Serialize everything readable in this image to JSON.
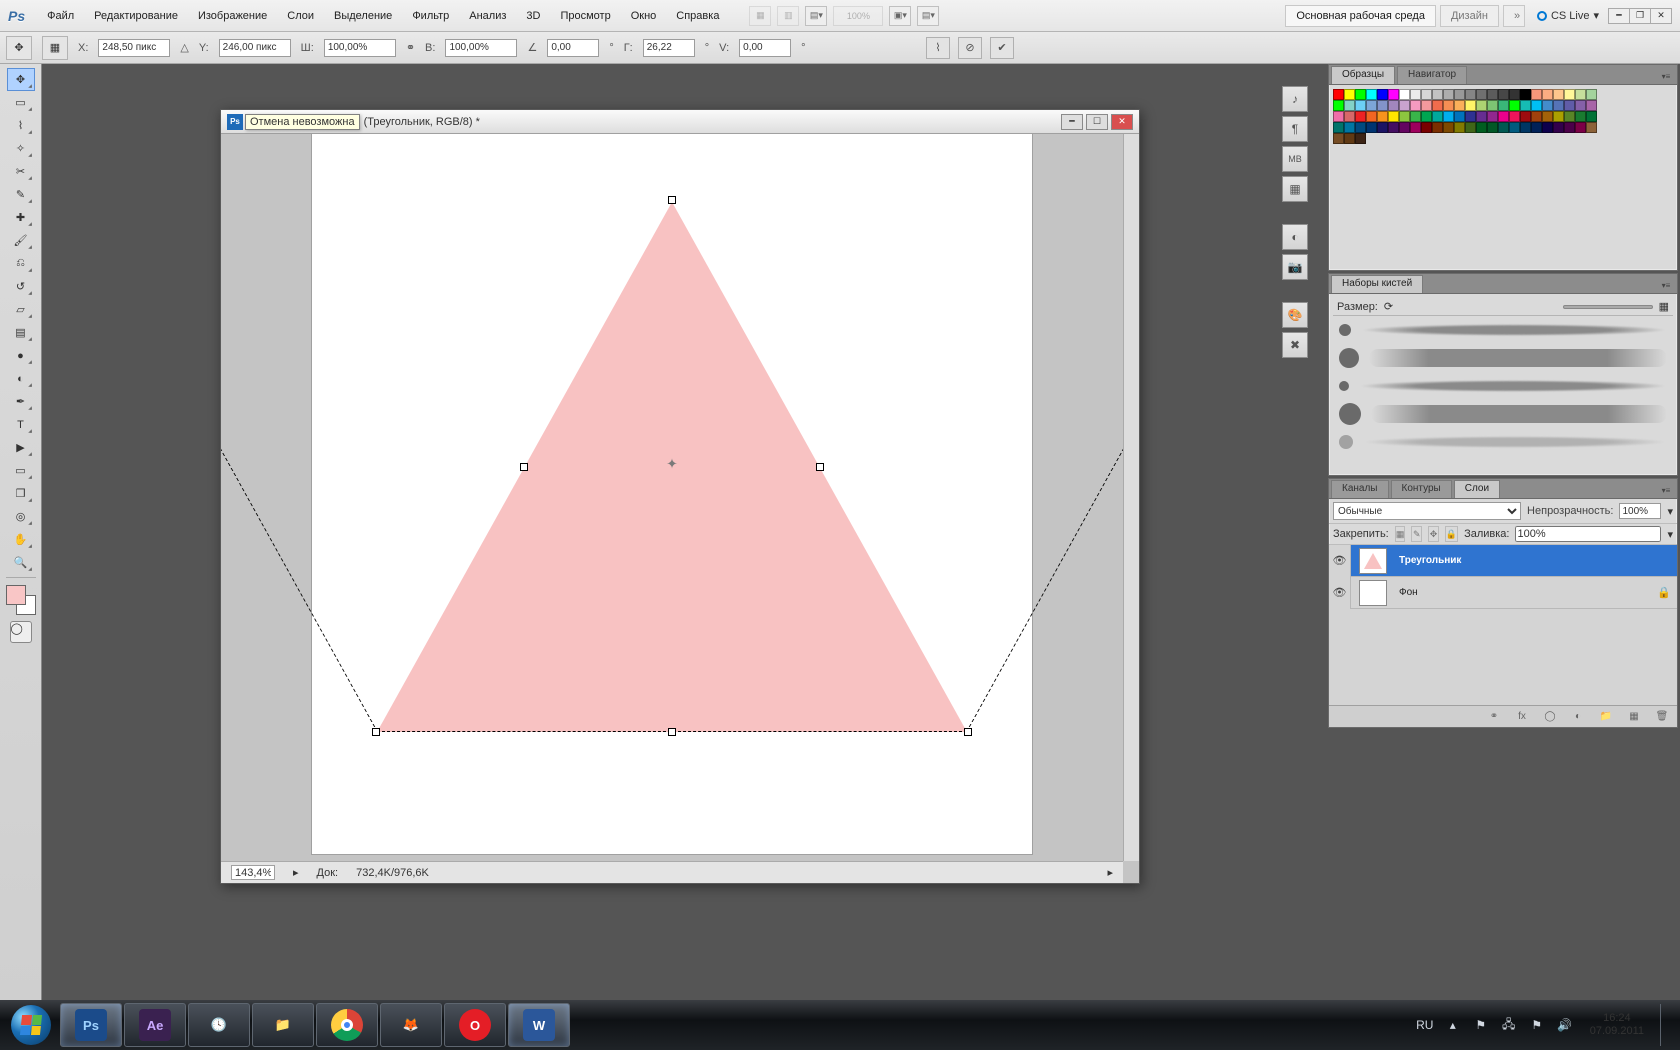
{
  "app": {
    "logo": "Ps"
  },
  "menu": {
    "file": "Файл",
    "edit": "Редактирование",
    "image": "Изображение",
    "layers": "Слои",
    "select": "Выделение",
    "filter": "Фильтр",
    "analysis": "Анализ",
    "3d": "3D",
    "view": "Просмотр",
    "window": "Окно",
    "help": "Справка"
  },
  "top_extra": {
    "zoom_pct": "100%"
  },
  "workspaces": {
    "main": "Основная рабочая среда",
    "design": "Дизайн"
  },
  "cslive": "CS Live",
  "options": {
    "x_label": "X:",
    "x_val": "248,50 пикс",
    "y_label": "Y:",
    "y_val": "246,00 пикс",
    "w_label": "Ш:",
    "w_val": "100,00%",
    "h_label": "В:",
    "h_val": "100,00%",
    "ang_label": "",
    "ang_val": "0,00",
    "gdeg": "°",
    "gh_label": "Г:",
    "gh_val": "26,22",
    "gv_label": "V:",
    "gv_val": "0,00"
  },
  "doc": {
    "tooltip": "Отмена невозможна",
    "title": "(Треугольник, RGB/8) *",
    "zoom": "143,4%",
    "docsize_label": "Док:",
    "docsize": "732,4K/976,6K"
  },
  "panels": {
    "swatches": {
      "tab1": "Образцы",
      "tab2": "Навигатор"
    },
    "brushes": {
      "tab": "Наборы кистей",
      "size_label": "Размер:"
    },
    "channels": "Каналы",
    "paths": "Контуры",
    "layers": "Слои",
    "blend": "Обычные",
    "opacity_label": "Непрозрачность:",
    "opacity_val": "100%",
    "lock_label": "Закрепить:",
    "fill_label": "Заливка:",
    "fill_val": "100%",
    "layer1": "Треугольник",
    "layer2": "Фон"
  },
  "swatches_colors": [
    "#ff0000",
    "#ffff00",
    "#00ff00",
    "#00ffff",
    "#0000ff",
    "#ff00ff",
    "#ffffff",
    "#ebebeb",
    "#d6d6d6",
    "#c2c2c2",
    "#adadad",
    "#999999",
    "#858585",
    "#707070",
    "#5c5c5c",
    "#474747",
    "#333333",
    "#000000",
    "#f7977a",
    "#fbad82",
    "#fdc68c",
    "#fff799",
    "#c6df9c",
    "#a4d49d",
    "#00ff00",
    "#83d2c7",
    "#6ccff6",
    "#7ca6d8",
    "#8293ca",
    "#a286bd",
    "#c9a3ce",
    "#f49ac0",
    "#f5999d",
    "#f16c4d",
    "#f68e54",
    "#fbaf5a",
    "#fff467",
    "#acd372",
    "#7dc473",
    "#39b778",
    "#00ff00",
    "#16bcb4",
    "#00bff3",
    "#438ccb",
    "#5573b7",
    "#605ca8",
    "#8560a8",
    "#a864a8",
    "#ef6ea8",
    "#d86769",
    "#ed2224",
    "#f26522",
    "#f7941d",
    "#ffe600",
    "#8cc63f",
    "#39b54a",
    "#00a651",
    "#00a99d",
    "#00aeef",
    "#0072bc",
    "#2e3192",
    "#662d91",
    "#92278f",
    "#ec008c",
    "#ed145b",
    "#9e0b0f",
    "#a0410d",
    "#a36209",
    "#aba000",
    "#598527",
    "#197b30",
    "#007236",
    "#00746b",
    "#0076a3",
    "#004a80",
    "#003471",
    "#1b1464",
    "#440e62",
    "#630460",
    "#9e005d",
    "#790000",
    "#7b2e00",
    "#7d4900",
    "#827b00",
    "#406618",
    "#005e20",
    "#005826",
    "#005952",
    "#005b7f",
    "#003663",
    "#002157",
    "#0d004c",
    "#32004b",
    "#4b0049",
    "#7b0046",
    "#8c6239",
    "#754c24",
    "#603913",
    "#3c2415"
  ],
  "taskbar": {
    "lang": "RU",
    "time": "16:24",
    "date": "07.09.2011"
  }
}
